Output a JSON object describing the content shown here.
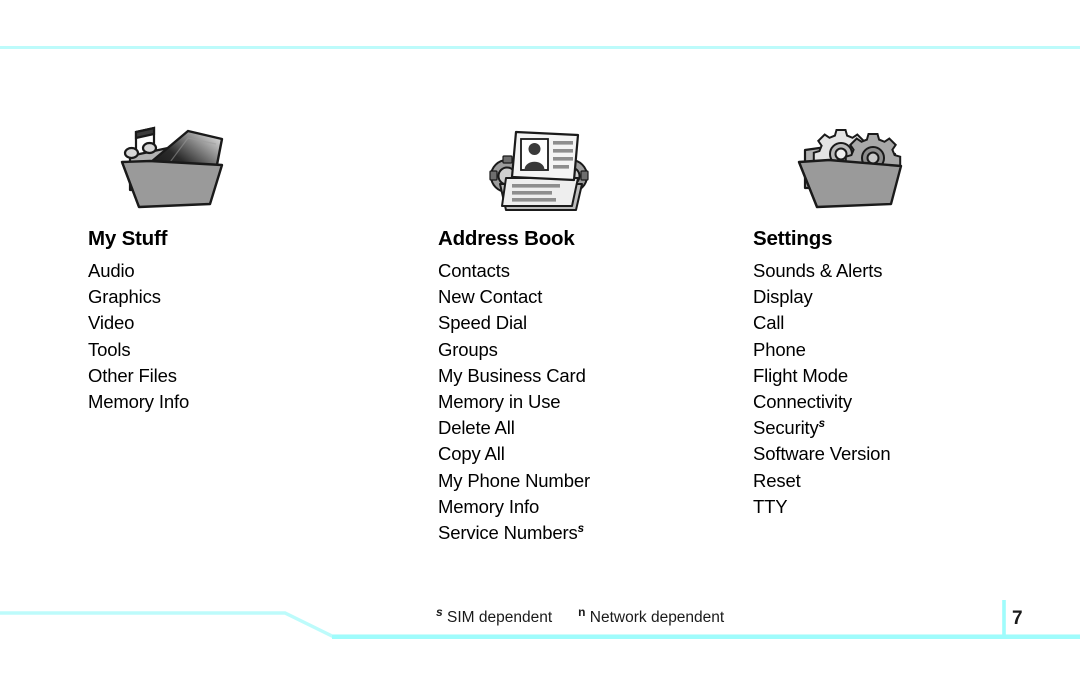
{
  "page": {
    "number": "7",
    "accent_color": "#bdfbfb",
    "accent_color_bright": "#9ffcfc"
  },
  "columns": [
    {
      "icon": "folder-media-icon",
      "title": "My Stuff",
      "items": [
        {
          "label": "Audio",
          "marker": ""
        },
        {
          "label": "Graphics",
          "marker": ""
        },
        {
          "label": "Video",
          "marker": ""
        },
        {
          "label": "Tools",
          "marker": ""
        },
        {
          "label": "Other Files",
          "marker": ""
        },
        {
          "label": "Memory Info",
          "marker": ""
        }
      ]
    },
    {
      "icon": "rolodex-contact-card-icon",
      "title": "Address Book",
      "items": [
        {
          "label": "Contacts",
          "marker": ""
        },
        {
          "label": "New Contact",
          "marker": ""
        },
        {
          "label": "Speed Dial",
          "marker": ""
        },
        {
          "label": "Groups",
          "marker": ""
        },
        {
          "label": "My Business Card",
          "marker": ""
        },
        {
          "label": "Memory in Use",
          "marker": ""
        },
        {
          "label": "Delete All",
          "marker": ""
        },
        {
          "label": "Copy All",
          "marker": ""
        },
        {
          "label": "My Phone Number",
          "marker": ""
        },
        {
          "label": "Memory Info",
          "marker": ""
        },
        {
          "label": "Service Numbers",
          "marker": "s"
        }
      ]
    },
    {
      "icon": "folder-gears-icon",
      "title": "Settings",
      "items": [
        {
          "label": "Sounds & Alerts",
          "marker": ""
        },
        {
          "label": "Display",
          "marker": ""
        },
        {
          "label": "Call",
          "marker": ""
        },
        {
          "label": "Phone",
          "marker": ""
        },
        {
          "label": "Flight Mode",
          "marker": ""
        },
        {
          "label": "Connectivity",
          "marker": ""
        },
        {
          "label": "Security",
          "marker": "s"
        },
        {
          "label": "Software Version",
          "marker": ""
        },
        {
          "label": "Reset",
          "marker": ""
        },
        {
          "label": "TTY",
          "marker": ""
        }
      ]
    }
  ],
  "footnotes": [
    {
      "marker": "s",
      "text": "SIM dependent"
    },
    {
      "marker": "n",
      "text": "Network dependent"
    }
  ]
}
